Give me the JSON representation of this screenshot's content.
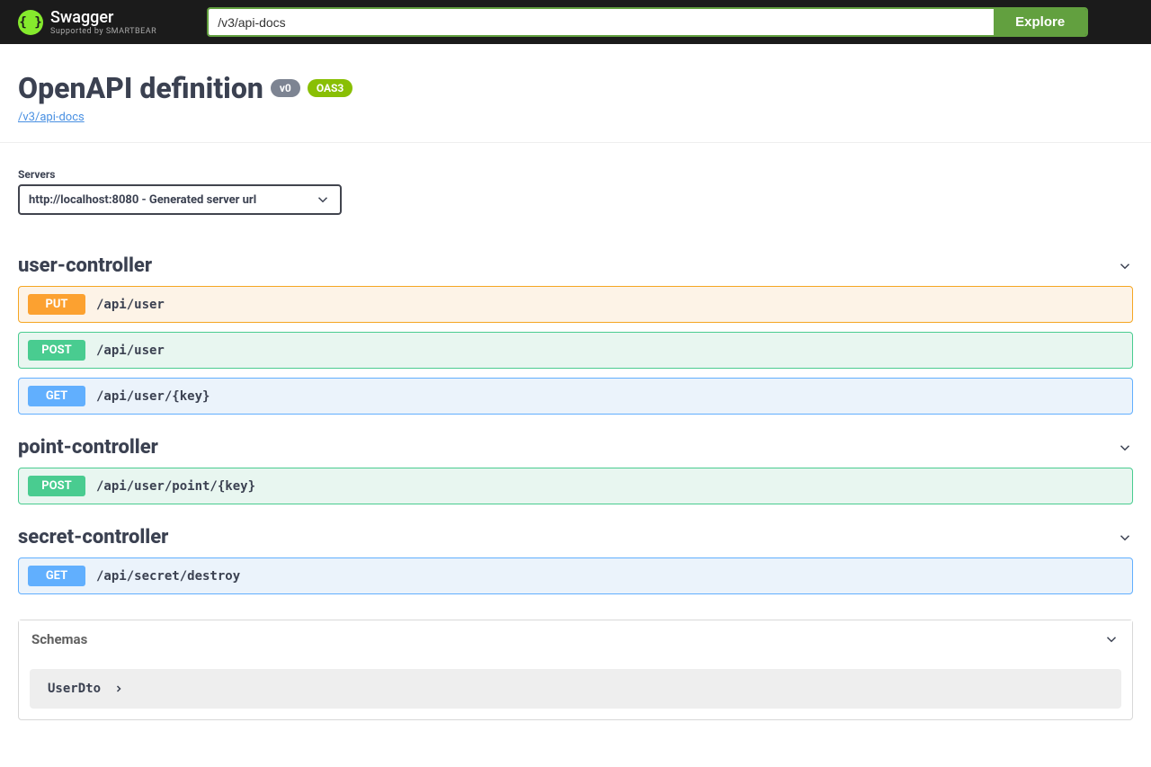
{
  "topbar": {
    "brand": "Swagger",
    "brand_sub": "Supported by SMARTBEAR",
    "url_value": "/v3/api-docs",
    "explore_label": "Explore"
  },
  "info": {
    "title": "OpenAPI definition",
    "version_badge": "v0",
    "oas_badge": "OAS3",
    "base_url": "/v3/api-docs"
  },
  "servers": {
    "label": "Servers",
    "selected": "http://localhost:8080 - Generated server url"
  },
  "tags": [
    {
      "name": "user-controller",
      "ops": [
        {
          "method": "PUT",
          "class": "op-put",
          "path": "/api/user"
        },
        {
          "method": "POST",
          "class": "op-post",
          "path": "/api/user"
        },
        {
          "method": "GET",
          "class": "op-get",
          "path": "/api/user/{key}"
        }
      ]
    },
    {
      "name": "point-controller",
      "ops": [
        {
          "method": "POST",
          "class": "op-post",
          "path": "/api/user/point/{key}"
        }
      ]
    },
    {
      "name": "secret-controller",
      "ops": [
        {
          "method": "GET",
          "class": "op-get",
          "path": "/api/secret/destroy"
        }
      ]
    }
  ],
  "schemas": {
    "title": "Schemas",
    "items": [
      {
        "name": "UserDto"
      }
    ]
  }
}
